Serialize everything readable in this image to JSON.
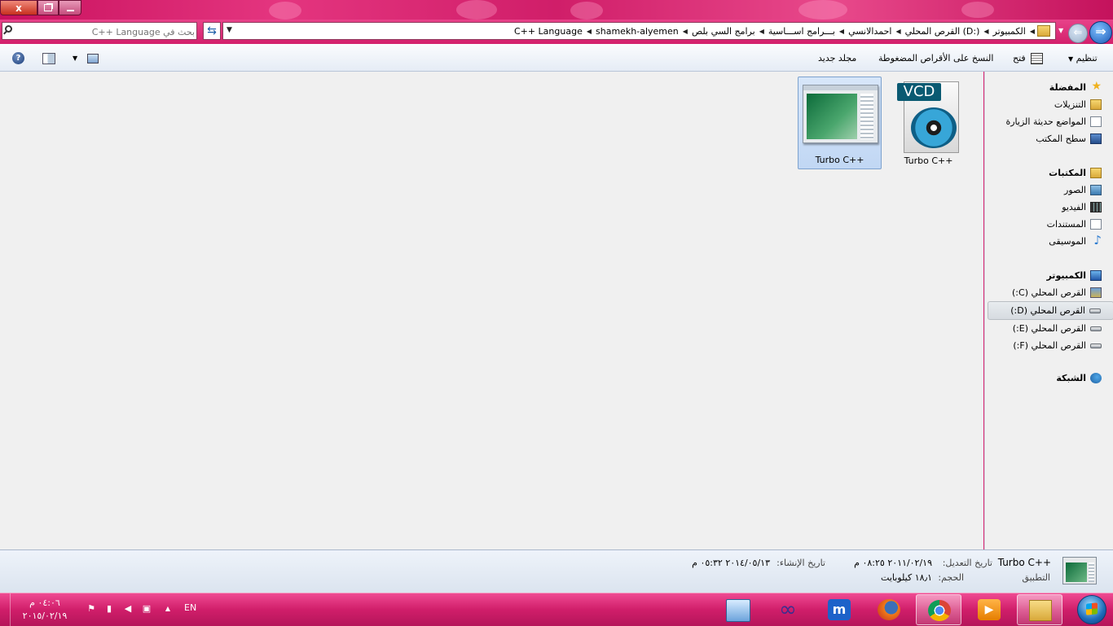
{
  "window": {
    "controls": {
      "close": "x",
      "restore": "",
      "minimize": ""
    }
  },
  "navigation": {
    "search_placeholder": "بحث في C++ Language",
    "breadcrumb": [
      "الكمبيوتر",
      "القرص المحلي (D:)",
      "احمدالانسي",
      "بـــرامج اســـاسية",
      "برامج السي بلص",
      "shamekh-alyemen",
      "C++ Language"
    ]
  },
  "toolbar": {
    "organize": "تنظيم",
    "open": "فتح",
    "burn": "النسخ على الأقراص المضغوطة",
    "new_folder": "مجلد جديد"
  },
  "files": [
    {
      "name": "Turbo C++",
      "icon": "vcd-media-icon",
      "selected": false
    },
    {
      "name": "Turbo C++",
      "icon": "turbo-app-icon",
      "selected": true
    }
  ],
  "nav_pane": {
    "favorites": {
      "header": "المفضلة",
      "items": [
        "التنزيلات",
        "المواضع حديثة الزيارة",
        "سطح المكتب"
      ]
    },
    "libraries": {
      "header": "المكتبات",
      "items": [
        "الصور",
        "الفيديو",
        "المستندات",
        "الموسيقى"
      ]
    },
    "computer": {
      "header": "الكمبيوتر",
      "items": [
        "القرص المحلي (C:)",
        "القرص المحلي (D:)",
        "القرص المحلي (E:)",
        "القرص المحلي (F:)"
      ]
    },
    "network": {
      "header": "الشبكة"
    }
  },
  "details": {
    "name": "Turbo C++",
    "type": "التطبيق",
    "modified_label": "تاريخ التعديل:",
    "modified_value": "٢٠١١/٠٢/١٩ ٠٨:٢٥ م",
    "size_label": "الحجم:",
    "size_value": "١٨٫١ كيلوبايت",
    "created_label": "تاريخ الإنشاء:",
    "created_value": "٢٠١٤/٠٥/١٣ ٠٥:٣٢ م"
  },
  "taskbar": {
    "language": "EN",
    "time": "٠٤:٠٦ م",
    "date": "٢٠١٥/٠٢/١٩",
    "apps": [
      "explorer-icon",
      "media-player-icon",
      "chrome-icon",
      "firefox-icon",
      "maxthon-icon",
      "infinity-icon",
      "control-panel-icon"
    ]
  },
  "colors": {
    "titlebar": "#d8236f",
    "taskbar": "#d01e6a",
    "selection": "#c1d7f4",
    "pane_background": "#f0f0f0"
  }
}
